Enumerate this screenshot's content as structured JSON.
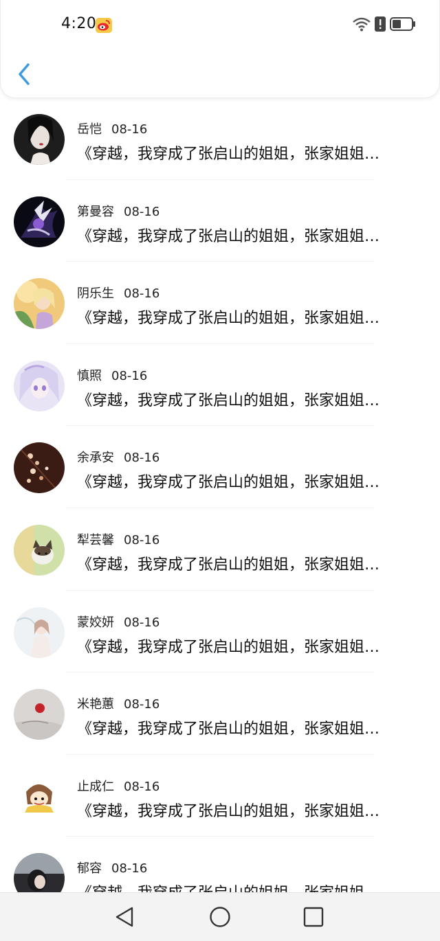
{
  "status_bar": {
    "time": "4:20",
    "notification_icon": "weibo-icon",
    "right_icons": [
      "wifi-icon",
      "alert-icon",
      "battery-icon"
    ]
  },
  "header": {
    "back_icon": "chevron-left-icon",
    "accent_color": "#3a9be0"
  },
  "list": {
    "rows": [
      {
        "name": "岳恺",
        "date": "08-16",
        "title": "《穿越，我穿成了张启山的姐姐，张家姐姐…",
        "avatar_colors": [
          "#1d1d1d",
          "#e9e2dc"
        ]
      },
      {
        "name": "第曼容",
        "date": "08-16",
        "title": "《穿越，我穿成了张启山的姐姐，张家姐姐…",
        "avatar_colors": [
          "#0a0a14",
          "#8a5bd1"
        ]
      },
      {
        "name": "阴乐生",
        "date": "08-16",
        "title": "《穿越，我穿成了张启山的姐姐，张家姐姐…",
        "avatar_colors": [
          "#f0c97a",
          "#6b9d54"
        ]
      },
      {
        "name": "慎照",
        "date": "08-16",
        "title": "《穿越，我穿成了张启山的姐姐，张家姐姐…",
        "avatar_colors": [
          "#e8e4f6",
          "#b8a7e0"
        ]
      },
      {
        "name": "余承安",
        "date": "08-16",
        "title": "《穿越，我穿成了张启山的姐姐，张家姐姐…",
        "avatar_colors": [
          "#3a1c15",
          "#d8a27a"
        ]
      },
      {
        "name": "犁芸馨",
        "date": "08-16",
        "title": "《穿越，我穿成了张启山的姐姐，张家姐姐…",
        "avatar_colors": [
          "#cfe0a8",
          "#6d5a44"
        ]
      },
      {
        "name": "蒙姣妍",
        "date": "08-16",
        "title": "《穿越，我穿成了张启山的姐姐，张家姐姐…",
        "avatar_colors": [
          "#eef2f4",
          "#c9a89a"
        ]
      },
      {
        "name": "米艳蕙",
        "date": "08-16",
        "title": "《穿越，我穿成了张启山的姐姐，张家姐姐…",
        "avatar_colors": [
          "#d9d6d4",
          "#c4232a"
        ]
      },
      {
        "name": "止成仁",
        "date": "08-16",
        "title": "《穿越，我穿成了张启山的姐姐，张家姐姐…",
        "avatar_colors": [
          "#ffffff",
          "#8a5a3a"
        ]
      },
      {
        "name": "郁容",
        "date": "08-16",
        "title": "《穿越，我穿成了张启山的姐姐，张家姐姐…",
        "avatar_colors": [
          "#2b2b2f",
          "#9aa1a8"
        ]
      }
    ]
  },
  "nav_bar": {
    "buttons": [
      "back-triangle-icon",
      "home-circle-icon",
      "recents-square-icon"
    ]
  }
}
